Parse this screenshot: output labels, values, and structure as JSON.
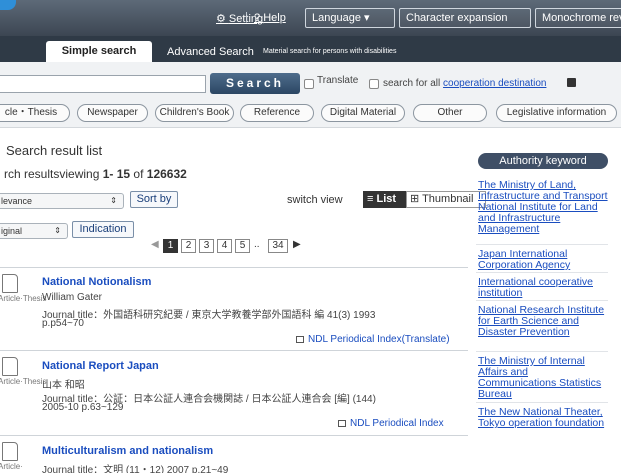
{
  "topbar": {
    "setting": "Setting",
    "help": "Help",
    "language": "Language",
    "character_expansion": "Character expansion",
    "monochrome": "Monochrome reverse"
  },
  "tabs": {
    "simple": "Simple search",
    "advanced": "Advanced Search",
    "disabilities": "Material search for persons with disabilities"
  },
  "search": {
    "value": "",
    "button": "Search",
    "translate": "Translate",
    "coop_prefix": "search for all ",
    "coop_link": "cooperation destination"
  },
  "filters": [
    "cle・Thesis",
    "Newspaper",
    "Children's Book",
    "Reference",
    "Digital Material",
    "Other",
    "Legislative information"
  ],
  "results": {
    "title": "Search result list",
    "count_prefix": "rch resultsviewing",
    "range": "1- 15",
    "of": "of",
    "total": "126632",
    "sort_select": "levance",
    "sort_button": "Sort by",
    "switch_view": "switch view",
    "view_list": "List",
    "view_thumbnail": "Thumbnail",
    "display_select": "iginal",
    "indication": "Indication",
    "pages": [
      "1",
      "2",
      "3",
      "4",
      "5",
      "34"
    ],
    "ellipsis": "..",
    "items": [
      {
        "type": "Article·Thesis",
        "title": "National Notionalism",
        "author": "William Gater",
        "journal": "Journal title：外国語科研究紀要 / 東京大学教養学部外国語科 編  41(3)  1993",
        "pages": "p.p54~70",
        "link": "NDL Periodical Index(Translate)"
      },
      {
        "type": "Article·Thesis",
        "title": "National Report Japan",
        "author": "山本 和昭",
        "journal": "Journal title：公証：日本公証人連合会機関誌 / 日本公証人連合会 [編]  (144)",
        "pages": "2005-10  p.63~129",
        "link": "NDL Periodical Index"
      },
      {
        "type": "Article·",
        "title": "Multiculturalism and nationalism",
        "author": "",
        "journal": "Journal title：文明  (11・12)  2007  p.21~49",
        "pages": "",
        "link": ""
      }
    ]
  },
  "sidebar": {
    "heading": "Authority keyword",
    "links": [
      "The Ministry of Land, Infrastructure and Transport National Institute for Land and Infrastructure Management",
      "Japan International Corporation Agency",
      "International cooperative institution",
      "National Research Institute for Earth Science and Disaster Prevention",
      "The Ministry of Internal Affairs and Communications Statistics Bureau",
      "The New National Theater, Tokyo operation foundation"
    ]
  }
}
